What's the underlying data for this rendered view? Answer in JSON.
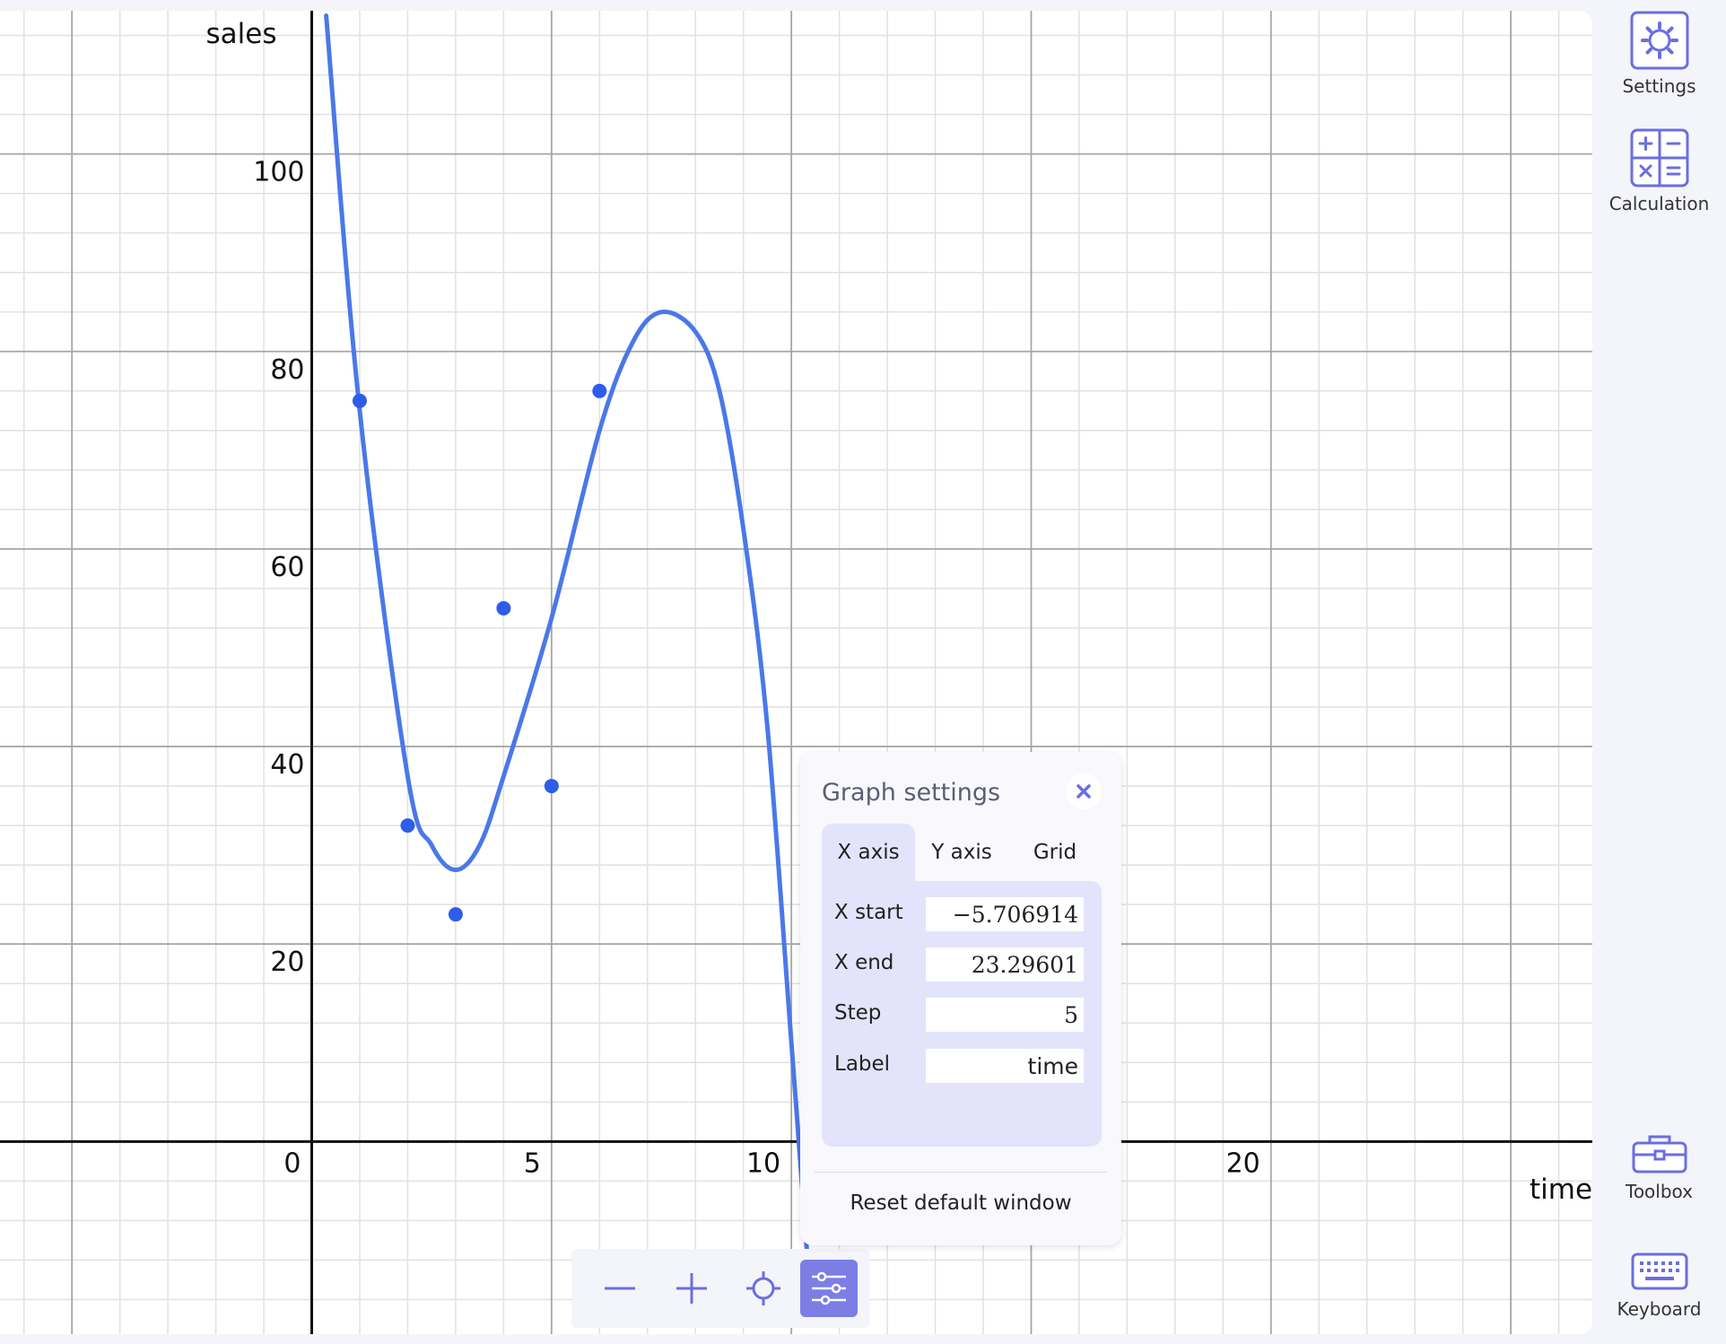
{
  "chart_data": {
    "type": "scatter",
    "xlabel": "time",
    "ylabel": "sales",
    "xlim": [
      -6.5,
      26.7
    ],
    "ylim": [
      -19.5,
      114.5
    ],
    "x_ticks": [
      0,
      5,
      10,
      20
    ],
    "y_ticks": [
      20,
      40,
      60,
      80,
      100
    ],
    "grid": true,
    "points": [
      {
        "x": 1,
        "y": 75
      },
      {
        "x": 2,
        "y": 32
      },
      {
        "x": 3,
        "y": 23
      },
      {
        "x": 4,
        "y": 54
      },
      {
        "x": 5,
        "y": 36
      },
      {
        "x": 6,
        "y": 76
      }
    ],
    "curve": [
      {
        "x": 0.3,
        "y": 114
      },
      {
        "x": 1.0,
        "y": 74
      },
      {
        "x": 2.0,
        "y": 37
      },
      {
        "x": 2.5,
        "y": 30
      },
      {
        "x": 3.0,
        "y": 27.5
      },
      {
        "x": 3.5,
        "y": 30
      },
      {
        "x": 4.0,
        "y": 37
      },
      {
        "x": 5.0,
        "y": 53
      },
      {
        "x": 6.0,
        "y": 72
      },
      {
        "x": 6.7,
        "y": 81
      },
      {
        "x": 7.3,
        "y": 84
      },
      {
        "x": 8.0,
        "y": 82
      },
      {
        "x": 8.5,
        "y": 76
      },
      {
        "x": 9.0,
        "y": 62
      },
      {
        "x": 9.5,
        "y": 42
      },
      {
        "x": 10.0,
        "y": 10
      },
      {
        "x": 10.4,
        "y": -16
      }
    ],
    "colors": {
      "curve": "#4a78e8",
      "points": "#2d5de9",
      "axis": "#111111",
      "grid_major": "#a6a6a6",
      "grid_minor": "#e1e1e1"
    }
  },
  "sidebar": {
    "settings": "Settings",
    "calculation": "Calculation",
    "toolbox": "Toolbox",
    "keyboard": "Keyboard",
    "icon_color": "#6b6ee0"
  },
  "zoom_toolbar": {
    "icons": [
      "zoom-out-icon",
      "zoom-in-icon",
      "recenter-icon",
      "graph-settings-icon"
    ]
  },
  "graph_settings": {
    "title": "Graph settings",
    "tabs": [
      "X axis",
      "Y axis",
      "Grid"
    ],
    "active_tab": "X axis",
    "fields": [
      {
        "label": "X start",
        "value": "−5.706914"
      },
      {
        "label": "X end",
        "value": "23.29601"
      },
      {
        "label": "Step",
        "value": "5"
      },
      {
        "label": "Label",
        "value": "time"
      }
    ],
    "reset": "Reset default window"
  }
}
